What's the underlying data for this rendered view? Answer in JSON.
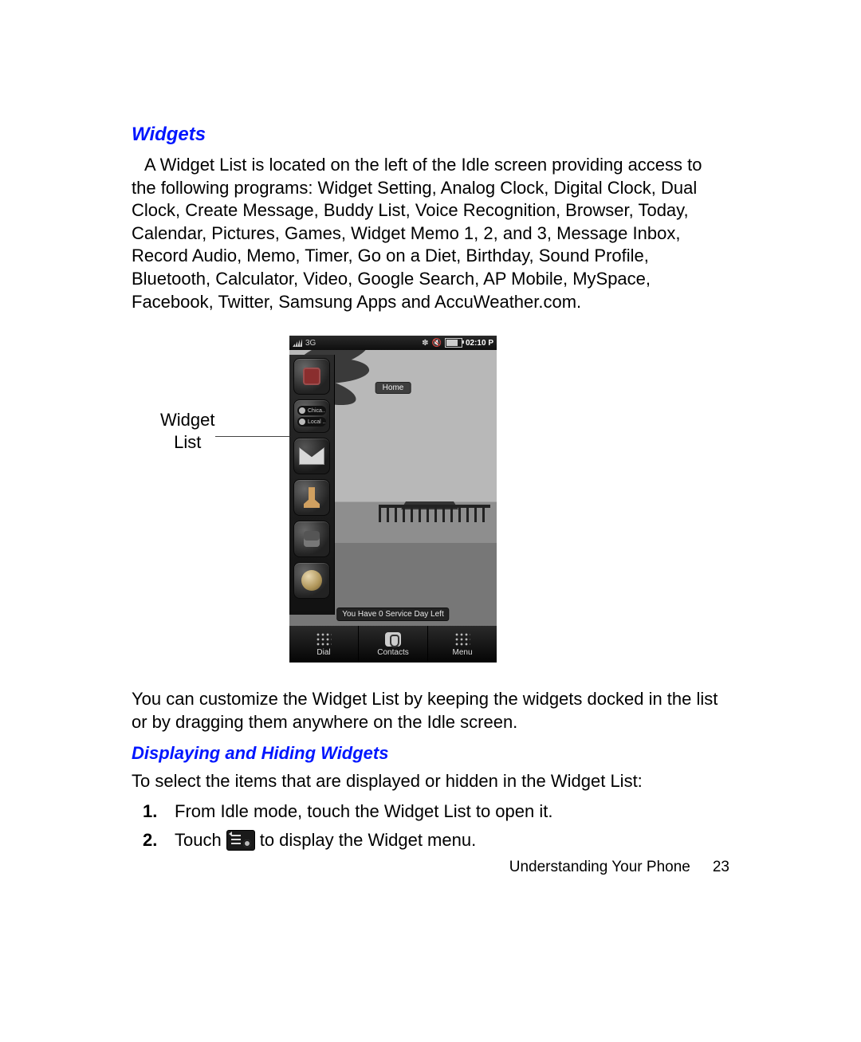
{
  "headings": {
    "widgets": "Widgets",
    "displaying": "Displaying and Hiding Widgets"
  },
  "paragraphs": {
    "intro": "A Widget List is located on the left of the Idle screen providing access to the following programs: Widget Setting, Analog Clock, Digital Clock, Dual Clock, Create Message, Buddy List, Voice Recognition, Browser, Today,  Calendar, Pictures, Games, Widget Memo 1, 2, and 3, Message Inbox, Record Audio, Memo, Timer, Go on a Diet, Birthday, Sound Profile, Bluetooth, Calculator, Video, Google Search, AP Mobile, MySpace, Facebook, Twitter, Samsung Apps and AccuWeather.com.",
    "customize": "You can customize the Widget List by keeping the widgets docked in the list or by dragging them anywhere on the Idle screen.",
    "select_intro": "To select the items that are displayed or hidden in the Widget List:"
  },
  "figure": {
    "caption_line1": "Widget",
    "caption_line2": "List",
    "statusbar_time": "02:10 P",
    "home_label": "Home",
    "clock_city1": "Chica..",
    "clock_city2": "Local ..",
    "service_banner": "You Have 0 Service Day Left",
    "bottombar": {
      "dial": "Dial",
      "contacts": "Contacts",
      "menu": "Menu"
    }
  },
  "steps": {
    "s1": "From Idle mode, touch the Widget List to open it.",
    "s2_a": "Touch",
    "s2_b": "to display the Widget menu."
  },
  "footer": {
    "section": "Understanding Your Phone",
    "page": "23"
  }
}
